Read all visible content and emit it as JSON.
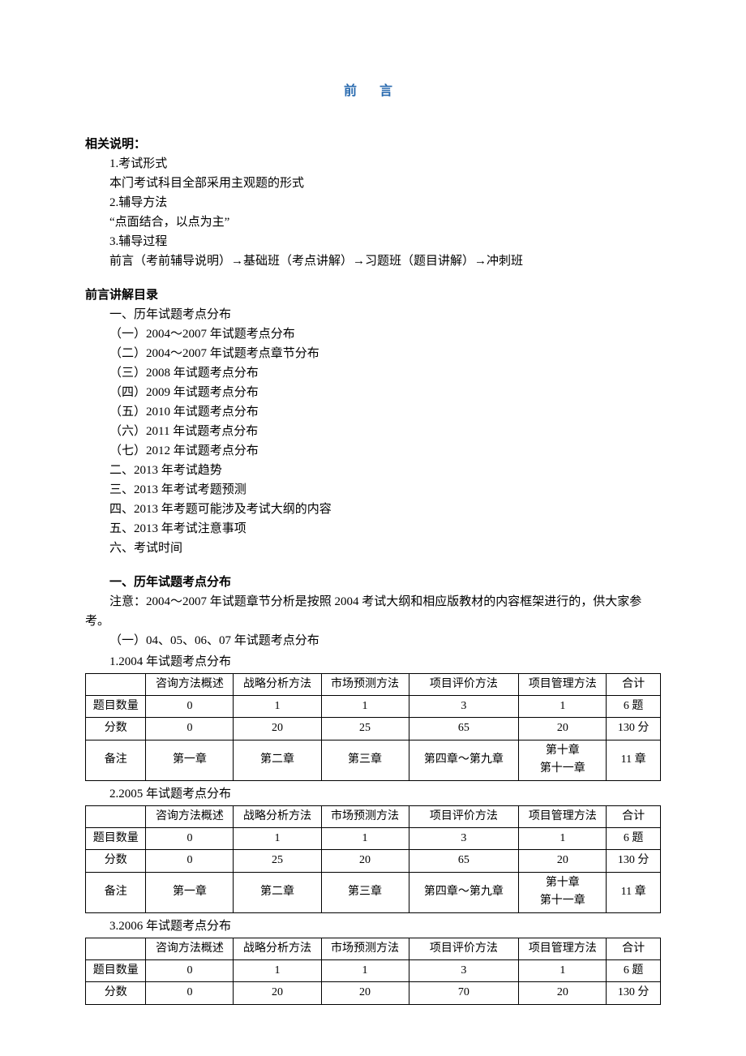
{
  "title": "前 言",
  "sec1_heading": "相关说明：",
  "sec1": {
    "p1": "1.考试形式",
    "p2": "本门考试科目全部采用主观题的形式",
    "p3": "2.辅导方法",
    "p4": "“点面结合，以点为主”",
    "p5": "3.辅导过程",
    "p6": "前言（考前辅导说明）→基础班（考点讲解）→习题班（题目讲解）→冲刺班"
  },
  "sec2_heading": "前言讲解目录",
  "sec2": {
    "i1": "一、历年试题考点分布",
    "i2": "（一）2004～2007 年试题考点分布",
    "i3": "（二）2004～2007 年试题考点章节分布",
    "i4": "（三）2008 年试题考点分布",
    "i5": "（四）2009 年试题考点分布",
    "i6": "（五）2010 年试题考点分布",
    "i7": "（六）2011 年试题考点分布",
    "i8": "（七）2012 年试题考点分布",
    "i9": "二、2013 年考试趋势",
    "i10": "三、2013 年考试考题预测",
    "i11": "四、2013 年考题可能涉及考试大纲的内容",
    "i12": "五、2013 年考试注意事项",
    "i13": "六、考试时间"
  },
  "sec3_heading": "一、历年试题考点分布",
  "sec3_note": "注意：2004～2007 年试题章节分析是按照 2004 考试大纲和相应版教材的内容框架进行的，供大家参考。",
  "sec3_sub": "（一）04、05、06、07 年试题考点分布",
  "headers": {
    "h0": "",
    "h1": "咨询方法概述",
    "h2": "战略分析方法",
    "h3": "市场预测方法",
    "h4": "项目评价方法",
    "h5": "项目管理方法",
    "h6": "合计"
  },
  "rowlabels": {
    "r1": "题目数量",
    "r2": "分数",
    "r3": "备注"
  },
  "notes": {
    "n1": "第一章",
    "n2": "第二章",
    "n3": "第三章",
    "n4": "第四章～第九章",
    "n5a": "第十章",
    "n5b": "第十一章",
    "n6": "11 章"
  },
  "t2004_cap": "1.2004 年试题考点分布",
  "t2004": {
    "q": {
      "c1": "0",
      "c2": "1",
      "c3": "1",
      "c4": "3",
      "c5": "1",
      "c6": "6 题"
    },
    "s": {
      "c1": "0",
      "c2": "20",
      "c3": "25",
      "c4": "65",
      "c5": "20",
      "c6": "130 分"
    }
  },
  "t2005_cap": "2.2005 年试题考点分布",
  "t2005": {
    "q": {
      "c1": "0",
      "c2": "1",
      "c3": "1",
      "c4": "3",
      "c5": "1",
      "c6": "6 题"
    },
    "s": {
      "c1": "0",
      "c2": "25",
      "c3": "20",
      "c4": "65",
      "c5": "20",
      "c6": "130 分"
    }
  },
  "t2006_cap": "3.2006 年试题考点分布",
  "t2006": {
    "q": {
      "c1": "0",
      "c2": "1",
      "c3": "1",
      "c4": "3",
      "c5": "1",
      "c6": "6 题"
    },
    "s": {
      "c1": "0",
      "c2": "20",
      "c3": "20",
      "c4": "70",
      "c5": "20",
      "c6": "130 分"
    }
  }
}
